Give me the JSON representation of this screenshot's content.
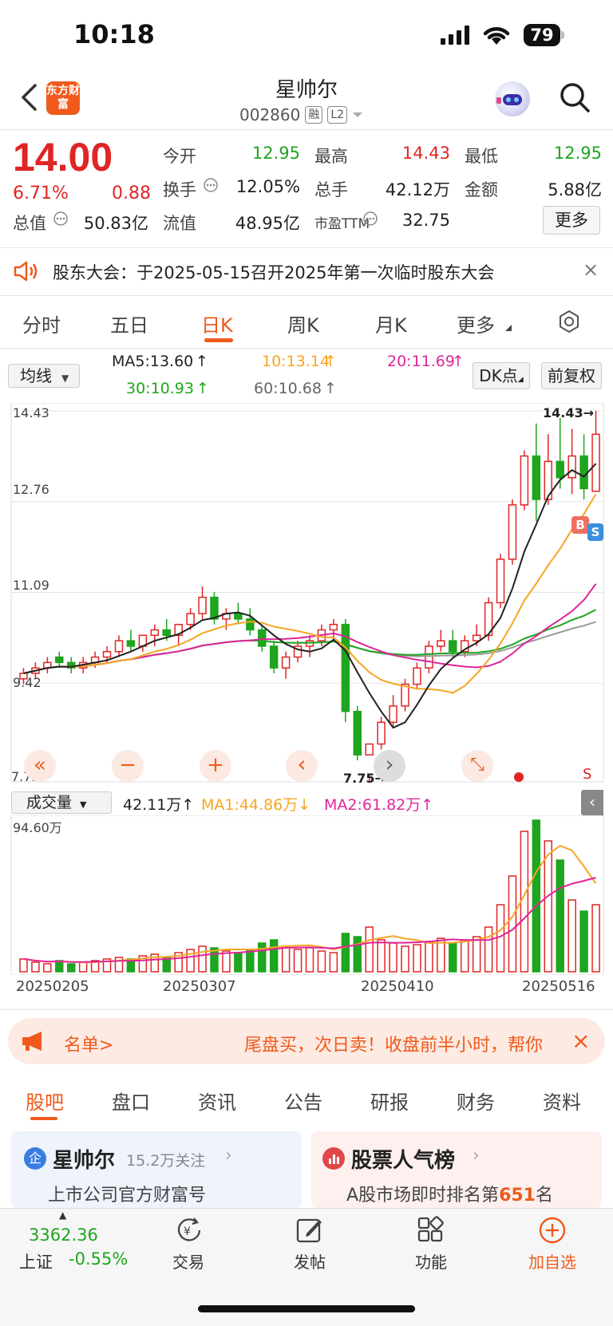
{
  "status": {
    "time": "10:18",
    "battery": "79"
  },
  "header": {
    "logo_text": "东方财富",
    "name": "星帅尔",
    "code": "002860",
    "tag_margin": "融",
    "tag_level": "L2"
  },
  "quote": {
    "price": "14.00",
    "change_pct": "6.71%",
    "change": "0.88",
    "fields": [
      {
        "label": "今开",
        "value": "12.95",
        "color": "green"
      },
      {
        "label": "最高",
        "value": "14.43",
        "color": "red"
      },
      {
        "label": "最低",
        "value": "12.95",
        "color": "green"
      },
      {
        "label": "换手",
        "value": "12.05%",
        "color": "plain"
      },
      {
        "label": "总手",
        "value": "42.12万",
        "color": "plain"
      },
      {
        "label": "金额",
        "value": "5.88亿",
        "color": "plain"
      },
      {
        "label": "总值",
        "value": "50.83亿",
        "color": "plain"
      },
      {
        "label": "流值",
        "value": "48.95亿",
        "color": "plain"
      },
      {
        "label": "市盈TTM",
        "value": "32.75",
        "color": "plain"
      }
    ],
    "more": "更多"
  },
  "notice": {
    "text": "股东大会：于2025-05-15召开2025年第一次临时股东大会",
    "close": "×"
  },
  "chart_tabs": [
    "分时",
    "五日",
    "日K",
    "周K",
    "月K",
    "更多"
  ],
  "ma_row": {
    "select": "均线",
    "ma5": "MA5:13.60",
    "ma10": "10:13.14",
    "ma20": "20:11.69",
    "ma30": "30:10.93",
    "ma60": "60:10.68",
    "dk": "DK点",
    "fq": "前复权"
  },
  "price_axis": {
    "top": "14.43",
    "l2": "12.76",
    "l3": "11.09",
    "l4": "9.42",
    "bottom": "7.75"
  },
  "markers": {
    "high": "14.43→",
    "low": "7.75→",
    "buy": "B",
    "sell": "S",
    "s_small": "S"
  },
  "volume_row": {
    "select": "成交量",
    "vol": "42.11万",
    "ma1": "MA1:44.86万",
    "ma2": "MA2:61.82万",
    "axis_top": "94.60万"
  },
  "date_axis": [
    "20250205",
    "20250307",
    "20250410",
    "20250516"
  ],
  "chart_data": {
    "type": "candlestick",
    "ylim": [
      7.75,
      14.43
    ],
    "dates_shown": [
      "20250205",
      "20250307",
      "20250410",
      "20250516"
    ],
    "last_close": 14.0,
    "high": 14.43,
    "low": 7.75,
    "candles": [
      [
        9.5,
        9.7,
        9.4,
        9.6
      ],
      [
        9.6,
        9.8,
        9.5,
        9.7
      ],
      [
        9.7,
        9.9,
        9.6,
        9.8
      ],
      [
        9.9,
        10.0,
        9.7,
        9.8
      ],
      [
        9.8,
        9.9,
        9.6,
        9.7
      ],
      [
        9.7,
        9.9,
        9.6,
        9.8
      ],
      [
        9.8,
        10.0,
        9.7,
        9.9
      ],
      [
        9.9,
        10.1,
        9.8,
        10.0
      ],
      [
        10.0,
        10.3,
        9.9,
        10.2
      ],
      [
        10.2,
        10.4,
        10.0,
        10.1
      ],
      [
        10.1,
        10.3,
        10.0,
        10.3
      ],
      [
        10.3,
        10.5,
        10.1,
        10.4
      ],
      [
        10.4,
        10.6,
        10.2,
        10.3
      ],
      [
        10.3,
        10.5,
        10.1,
        10.5
      ],
      [
        10.5,
        10.8,
        10.4,
        10.7
      ],
      [
        10.7,
        11.2,
        10.6,
        11.0
      ],
      [
        11.0,
        11.1,
        10.5,
        10.6
      ],
      [
        10.6,
        10.8,
        10.4,
        10.7
      ],
      [
        10.7,
        10.9,
        10.5,
        10.6
      ],
      [
        10.6,
        10.8,
        10.3,
        10.4
      ],
      [
        10.4,
        10.5,
        10.0,
        10.1
      ],
      [
        10.1,
        10.2,
        9.6,
        9.7
      ],
      [
        9.7,
        10.0,
        9.5,
        9.9
      ],
      [
        9.9,
        10.2,
        9.8,
        10.1
      ],
      [
        10.1,
        10.3,
        9.9,
        10.2
      ],
      [
        10.2,
        10.5,
        10.1,
        10.4
      ],
      [
        10.4,
        10.6,
        10.2,
        10.5
      ],
      [
        10.5,
        10.6,
        8.7,
        8.9
      ],
      [
        8.9,
        9.0,
        8.0,
        8.1
      ],
      [
        8.1,
        7.75,
        7.6,
        8.3
      ],
      [
        8.3,
        8.8,
        8.2,
        8.7
      ],
      [
        8.7,
        9.2,
        8.6,
        9.0
      ],
      [
        9.0,
        9.5,
        8.9,
        9.4
      ],
      [
        9.4,
        9.8,
        9.3,
        9.7
      ],
      [
        9.7,
        10.2,
        9.6,
        10.1
      ],
      [
        10.1,
        10.4,
        10.0,
        10.2
      ],
      [
        10.2,
        10.4,
        9.9,
        10.0
      ],
      [
        10.0,
        10.3,
        9.9,
        10.2
      ],
      [
        10.2,
        10.5,
        10.1,
        10.3
      ],
      [
        10.3,
        11.0,
        10.2,
        10.9
      ],
      [
        10.9,
        11.8,
        10.8,
        11.7
      ],
      [
        11.7,
        12.8,
        11.6,
        12.7
      ],
      [
        12.7,
        13.7,
        12.6,
        13.6
      ],
      [
        13.6,
        14.2,
        12.4,
        12.8
      ],
      [
        12.8,
        14.0,
        12.7,
        13.5
      ],
      [
        13.5,
        14.3,
        13.0,
        13.2
      ],
      [
        13.2,
        14.1,
        12.9,
        13.6
      ],
      [
        13.6,
        14.0,
        12.8,
        13.0
      ],
      [
        12.95,
        14.43,
        12.95,
        14.0
      ]
    ],
    "volumes": [
      8,
      6,
      5,
      7,
      5,
      6,
      7,
      8,
      9,
      8,
      10,
      11,
      9,
      12,
      14,
      16,
      15,
      13,
      12,
      14,
      18,
      20,
      16,
      14,
      15,
      13,
      12,
      24,
      22,
      28,
      20,
      18,
      16,
      17,
      19,
      21,
      18,
      20,
      22,
      28,
      42,
      60,
      88,
      95,
      82,
      70,
      45,
      38,
      42
    ]
  },
  "tools": [
    "«",
    "−",
    "+",
    "‹",
    "›",
    "⤡"
  ],
  "banner": {
    "left": "名单>",
    "text": "尾盘买，次日卖！收盘前半小时，帮你",
    "close": "×"
  },
  "bottom_tabs": [
    "股吧",
    "盘口",
    "资讯",
    "公告",
    "研报",
    "财务",
    "资料"
  ],
  "cards": {
    "left_title": "星帅尔",
    "left_followers": "15.2万关注",
    "left_sub": "上市公司官方财富号",
    "right_title": "股票人气榜",
    "right_sub_pre": "A股市场即时排名第",
    "right_rank": "651",
    "right_sub_post": "名"
  },
  "index": {
    "value": "3362.36",
    "name": "上证",
    "change": "-0.55%"
  },
  "nav": [
    "交易",
    "发帖",
    "功能",
    "加自选"
  ]
}
